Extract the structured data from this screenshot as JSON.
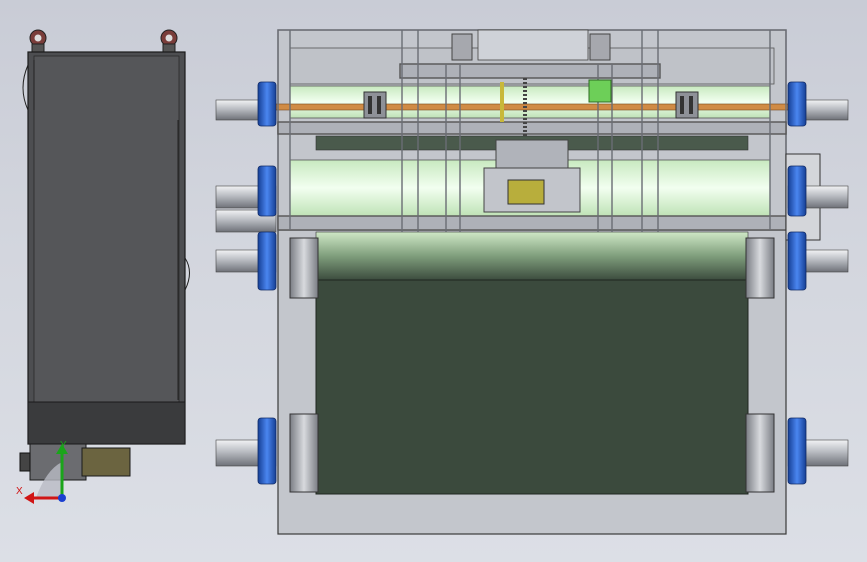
{
  "viewport": {
    "background_top": "#c9ccd6",
    "background_bottom": "#dcdfe6"
  },
  "model": {
    "side_view": "side-elevation",
    "front_view": "front-elevation",
    "belt_color": "#3a4a3c",
    "roller_glow": "#e4f7df",
    "bearing_blue": "#2b5ec8",
    "shaft_copper": "#d08b45",
    "frame_color": "#b9bcc4"
  },
  "triad": {
    "x_label": "X",
    "y_label": "Y",
    "x_color": "#d01515",
    "y_color": "#1aa51a",
    "z_color": "#1a3fd0"
  }
}
